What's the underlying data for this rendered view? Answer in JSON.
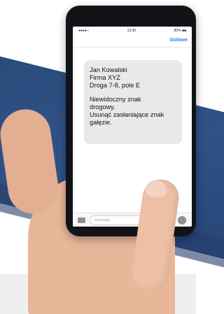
{
  "status": {
    "carrier": "●●●●○",
    "time": "12:30",
    "battery": "80% ■■"
  },
  "nav": {
    "done_label": "Gotowe"
  },
  "message": {
    "line1": "Jan Kowalski",
    "line2": "Firma XYZ",
    "line3": "Droga 7-8, pole E",
    "line4": "Niewidoczny znak",
    "line5": "drogowy.",
    "line6": "Usunąć zasłaniające znak",
    "line7": "gałęzie."
  },
  "input": {
    "placeholder": "Message"
  }
}
